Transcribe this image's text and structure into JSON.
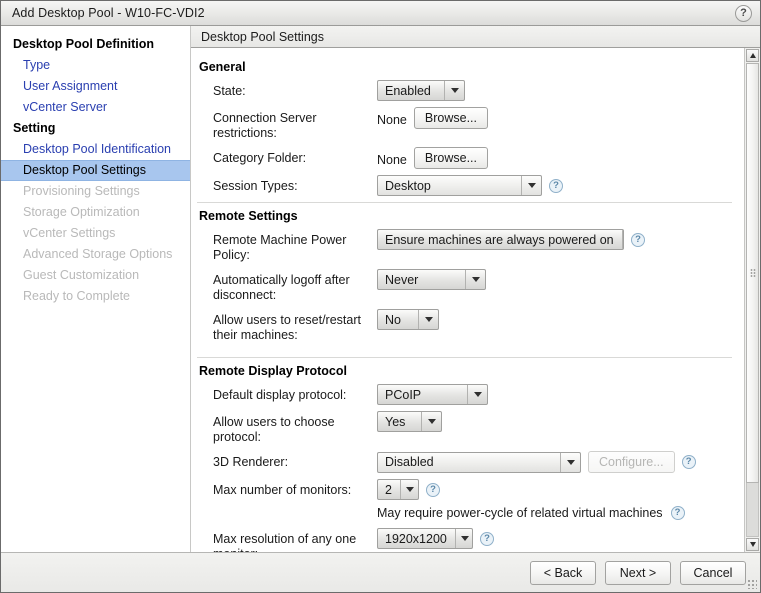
{
  "window": {
    "title": "Add Desktop Pool - W10-FC-VDI2",
    "help_icon_label": "?"
  },
  "sidebar": {
    "groups": [
      {
        "title": "Desktop Pool Definition",
        "items": [
          {
            "label": "Type",
            "state": "link"
          },
          {
            "label": "User Assignment",
            "state": "link"
          },
          {
            "label": "vCenter Server",
            "state": "link"
          }
        ]
      },
      {
        "title": "Setting",
        "items": [
          {
            "label": "Desktop Pool Identification",
            "state": "link"
          },
          {
            "label": "Desktop Pool Settings",
            "state": "selected"
          },
          {
            "label": "Provisioning Settings",
            "state": "disabled"
          },
          {
            "label": "Storage Optimization",
            "state": "disabled"
          },
          {
            "label": "vCenter Settings",
            "state": "disabled"
          },
          {
            "label": "Advanced Storage Options",
            "state": "disabled"
          },
          {
            "label": "Guest Customization",
            "state": "disabled"
          },
          {
            "label": "Ready to Complete",
            "state": "disabled"
          }
        ]
      }
    ]
  },
  "panel": {
    "header": "Desktop Pool Settings"
  },
  "sections": {
    "general": {
      "title": "General",
      "state": {
        "label": "State:",
        "value": "Enabled"
      },
      "connection_server": {
        "label": "Connection Server restrictions:",
        "value": "None",
        "button": "Browse..."
      },
      "category_folder": {
        "label": "Category Folder:",
        "value": "None",
        "button": "Browse..."
      },
      "session_types": {
        "label": "Session Types:",
        "value": "Desktop",
        "help": "?"
      }
    },
    "remote_settings": {
      "title": "Remote Settings",
      "power_policy": {
        "label": "Remote Machine Power Policy:",
        "value": "Ensure machines are always powered on",
        "help": "?"
      },
      "auto_logoff": {
        "label": "Automatically logoff after disconnect:",
        "value": "Never"
      },
      "allow_reset": {
        "label": "Allow users to reset/restart their machines:",
        "value": "No"
      }
    },
    "remote_display": {
      "title": "Remote Display Protocol",
      "default_protocol": {
        "label": "Default display protocol:",
        "value": "PCoIP"
      },
      "allow_choose": {
        "label": "Allow users to choose protocol:",
        "value": "Yes"
      },
      "renderer_3d": {
        "label": "3D Renderer:",
        "value": "Disabled",
        "button": "Configure...",
        "help": "?"
      },
      "max_monitors": {
        "label": "Max number of monitors:",
        "value": "2",
        "help": "?"
      },
      "power_cycle_note": {
        "text": "May require power-cycle of related virtual machines",
        "help": "?"
      },
      "max_resolution": {
        "label": "Max resolution of any one monitor:",
        "value": "1920x1200",
        "help": "?"
      }
    }
  },
  "footer": {
    "back": "< Back",
    "next": "Next >",
    "cancel": "Cancel"
  },
  "colors": {
    "selection": "#a8c6ee",
    "link": "#2a3fb0",
    "disabled": "#b9b9b9",
    "help_icon": "#5b87a8"
  }
}
